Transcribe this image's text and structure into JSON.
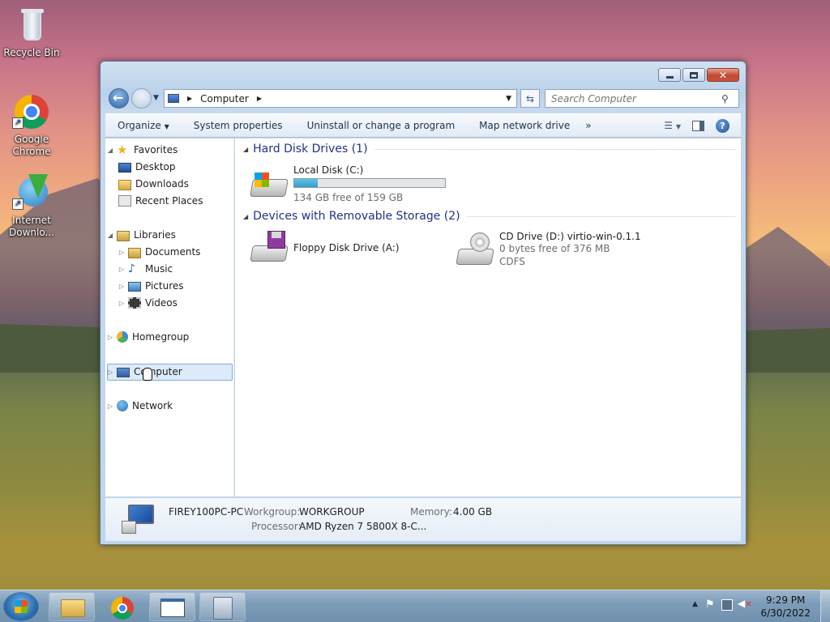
{
  "desktop": {
    "icons": [
      {
        "label": "Recycle Bin",
        "icon": "recycle-bin-icon"
      },
      {
        "label": "Google Chrome",
        "icon": "chrome-icon"
      },
      {
        "label": "Internet Downlo...",
        "icon": "internet-download-manager-icon"
      }
    ]
  },
  "window": {
    "address": {
      "path": "Computer"
    },
    "search": {
      "placeholder": "Search Computer"
    },
    "toolbar": {
      "organize": "Organize",
      "system_properties": "System properties",
      "uninstall": "Uninstall or change a program",
      "map_drive": "Map network drive",
      "more": "»"
    },
    "nav": {
      "favorites": "Favorites",
      "desktop": "Desktop",
      "downloads": "Downloads",
      "recent_places": "Recent Places",
      "libraries": "Libraries",
      "documents": "Documents",
      "music": "Music",
      "pictures": "Pictures",
      "videos": "Videos",
      "homegroup": "Homegroup",
      "computer": "Computer",
      "network": "Network"
    },
    "groups": {
      "hard_disks": "Hard Disk Drives (1)",
      "removable": "Devices with Removable Storage (2)"
    },
    "drives": {
      "c": {
        "name": "Local Disk (C:)",
        "free": "134 GB free of 159 GB",
        "used_fraction": 0.157
      },
      "a": {
        "name": "Floppy Disk Drive (A:)"
      },
      "d": {
        "name": "CD Drive (D:) virtio-win-0.1.1",
        "free": "0 bytes free of 376 MB",
        "fs": "CDFS"
      }
    },
    "details": {
      "pc_name": "FIREY100PC-PC",
      "workgroup_label": "Workgroup:",
      "workgroup_value": "WORKGROUP",
      "memory_label": "Memory:",
      "memory_value": "4.00 GB",
      "processor_label": "Processor:",
      "processor_value": "AMD Ryzen 7 5800X 8-C..."
    }
  },
  "taskbar": {
    "time": "9:29 PM",
    "date": "6/30/2022"
  },
  "colors": {
    "accent": "#1e3287",
    "selection": "#dceaf9",
    "disk_fill": "#2f9ec9"
  }
}
